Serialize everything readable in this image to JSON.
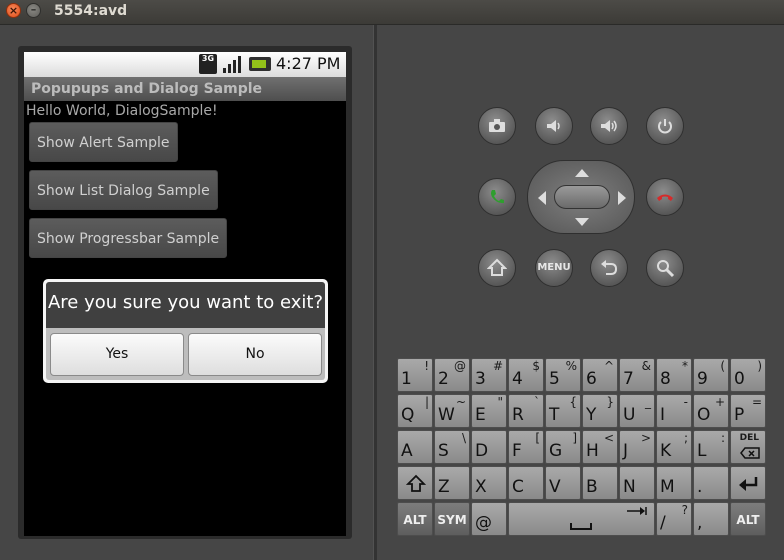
{
  "window": {
    "title": "5554:avd"
  },
  "status_bar": {
    "network": "3G",
    "time": "4:27 PM"
  },
  "app": {
    "title": "Popupups and Dialog Sample",
    "hello_text": "Hello World, DialogSample!",
    "buttons": [
      {
        "label": "Show Alert Sample"
      },
      {
        "label": "Show List Dialog Sample"
      },
      {
        "label": "Show Progressbar Sample"
      }
    ]
  },
  "dialog": {
    "message": "Are you sure you want to exit?",
    "positive": "Yes",
    "negative": "No"
  },
  "controls": {
    "menu_label": "MENU"
  },
  "keyboard": {
    "row1": [
      {
        "m": "1",
        "s": "!"
      },
      {
        "m": "2",
        "s": "@"
      },
      {
        "m": "3",
        "s": "#"
      },
      {
        "m": "4",
        "s": "$"
      },
      {
        "m": "5",
        "s": "%"
      },
      {
        "m": "6",
        "s": "^"
      },
      {
        "m": "7",
        "s": "&"
      },
      {
        "m": "8",
        "s": "*"
      },
      {
        "m": "9",
        "s": "("
      },
      {
        "m": "0",
        "s": ")"
      }
    ],
    "row2": [
      {
        "m": "Q",
        "s": "|"
      },
      {
        "m": "W",
        "s": "~"
      },
      {
        "m": "E",
        "s": "\""
      },
      {
        "m": "R",
        "s": "`"
      },
      {
        "m": "T",
        "s": "{"
      },
      {
        "m": "Y",
        "s": "}"
      },
      {
        "m": "U",
        "s": "_"
      },
      {
        "m": "I",
        "s": "-"
      },
      {
        "m": "O",
        "s": "+"
      },
      {
        "m": "P",
        "s": "="
      }
    ],
    "row3": [
      {
        "m": "A",
        "s": ""
      },
      {
        "m": "S",
        "s": "\\"
      },
      {
        "m": "D",
        "s": ""
      },
      {
        "m": "F",
        "s": "["
      },
      {
        "m": "G",
        "s": "]"
      },
      {
        "m": "H",
        "s": "<"
      },
      {
        "m": "J",
        "s": ">"
      },
      {
        "m": "K",
        "s": ";"
      },
      {
        "m": "L",
        "s": ":"
      }
    ],
    "row4": [
      {
        "m": "Z",
        "s": ""
      },
      {
        "m": "X",
        "s": ""
      },
      {
        "m": "C",
        "s": ""
      },
      {
        "m": "V",
        "s": ""
      },
      {
        "m": "B",
        "s": ""
      },
      {
        "m": "N",
        "s": ""
      },
      {
        "m": "M",
        "s": ""
      },
      {
        "m": ".",
        "s": ""
      }
    ],
    "row5": {
      "alt_left": "ALT",
      "sym": "SYM",
      "at": "@",
      "slash": "/",
      "slash_alt": "?",
      "comma": ",",
      "alt_right": "ALT"
    },
    "del_label": "DEL"
  }
}
